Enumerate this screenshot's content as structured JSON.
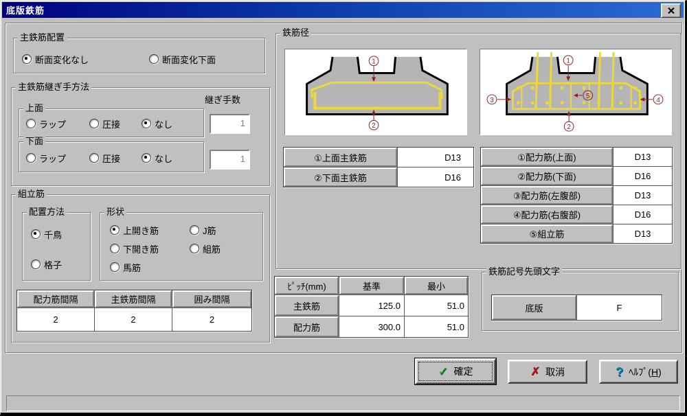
{
  "window": {
    "title": "底版鉄筋"
  },
  "colors": {
    "titlebar_left": "#000080",
    "titlebar_right": "#2a6cd4",
    "dialog_bg": "#c0c0c0",
    "rebar_yellow": "#edd83a",
    "annotation_red": "#8b2222",
    "disabled_text": "#808080",
    "ok_check_green": "#1f9620",
    "cancel_x_red": "#b01818",
    "help_q_blue": "#0e7fae"
  },
  "icons": {
    "ok_check": "✓",
    "cancel_x": "✗",
    "help_question": "?",
    "close_x": "×"
  },
  "main_rebar": {
    "title": "主鉄筋配置",
    "options": [
      {
        "label": "断面変化なし",
        "checked": true
      },
      {
        "label": "断面変化下面",
        "checked": false
      }
    ]
  },
  "joint": {
    "title": "主鉄筋継ぎ手方法",
    "count_label": "継ぎ手数",
    "top": {
      "title": "上面",
      "options": [
        {
          "label": "ラップ",
          "checked": false
        },
        {
          "label": "圧接",
          "checked": false
        },
        {
          "label": "なし",
          "checked": true
        }
      ],
      "count": "1"
    },
    "bottom": {
      "title": "下面",
      "options": [
        {
          "label": "ラップ",
          "checked": false
        },
        {
          "label": "圧接",
          "checked": false
        },
        {
          "label": "なし",
          "checked": true
        }
      ],
      "count": "1"
    }
  },
  "assembly": {
    "title": "組立筋",
    "arrangement": {
      "title": "配置方法",
      "options": [
        {
          "label": "千鳥",
          "checked": true
        },
        {
          "label": "格子",
          "checked": false
        }
      ]
    },
    "shape": {
      "title": "形状",
      "options": [
        {
          "label": "上開き筋",
          "checked": true
        },
        {
          "label": "J筋",
          "checked": false
        },
        {
          "label": "下開き筋",
          "checked": false
        },
        {
          "label": "組筋",
          "checked": false
        },
        {
          "label": "馬筋",
          "checked": false
        }
      ]
    },
    "spacing": {
      "headers": [
        "配力筋間隔",
        "主鉄筋間隔",
        "囲み間隔"
      ],
      "values": [
        "2",
        "2",
        "2"
      ]
    }
  },
  "diameter": {
    "title": "鉄筋径",
    "left_table": {
      "rows": [
        {
          "label": "①上面主鉄筋",
          "value": "D13"
        },
        {
          "label": "②下面主鉄筋",
          "value": "D16"
        }
      ]
    },
    "right_table": {
      "rows": [
        {
          "label": "①配力筋(上面)",
          "value": "D13"
        },
        {
          "label": "②配力筋(下面)",
          "value": "D16"
        },
        {
          "label": "③配力筋(左腹部)",
          "value": "D13"
        },
        {
          "label": "④配力筋(右腹部)",
          "value": "D16"
        },
        {
          "label": "⑤組立筋",
          "value": "D13"
        }
      ]
    },
    "left_diagram_marks": [
      "1",
      "2"
    ],
    "right_diagram_marks": [
      "1",
      "2",
      "3",
      "4",
      "5"
    ]
  },
  "pitch": {
    "headers": [
      "ﾋﾟｯﾁ(mm)",
      "基準",
      "最小"
    ],
    "rows": [
      {
        "label": "主鉄筋",
        "base": "125.0",
        "min": "51.0"
      },
      {
        "label": "配力筋",
        "base": "300.0",
        "min": "51.0"
      }
    ]
  },
  "prefix": {
    "title": "鉄筋記号先頭文字",
    "label": "底版",
    "value": "F"
  },
  "buttons": {
    "ok": "確定",
    "cancel": "取消",
    "help_pre": "ﾍﾙﾌﾟ(",
    "help_key": "H",
    "help_post": ")"
  }
}
